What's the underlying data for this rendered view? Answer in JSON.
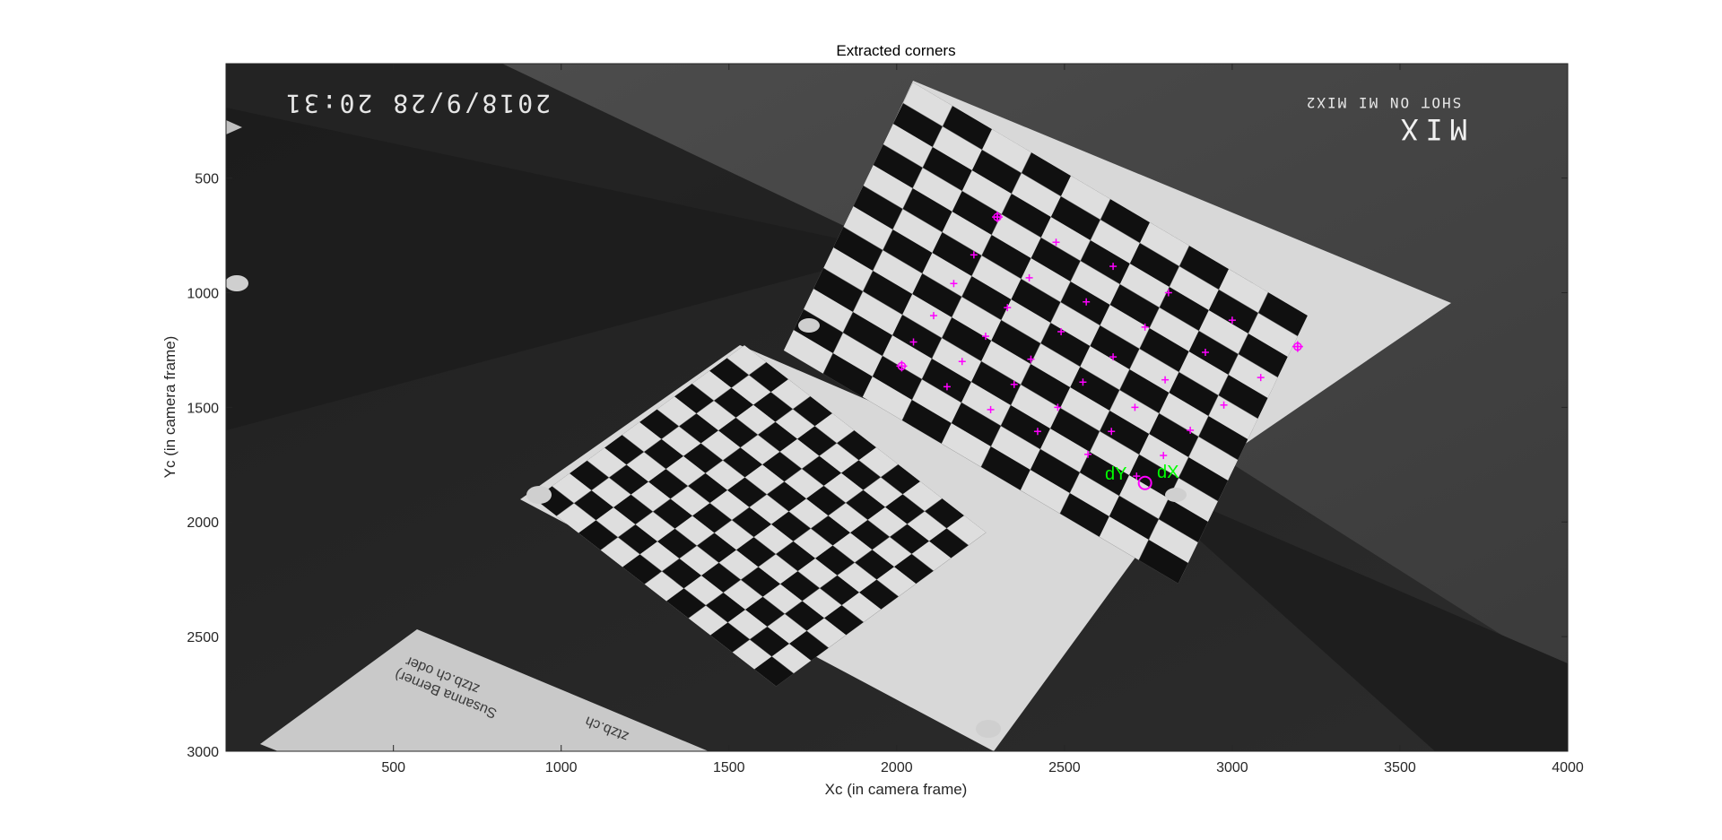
{
  "figure": {
    "title": "Extracted corners",
    "xlabel": "Xc (in camera frame)",
    "ylabel": "Yc (in camera frame)",
    "x_ticks": [
      "500",
      "1000",
      "1500",
      "2000",
      "2500",
      "3000",
      "3500",
      "4000"
    ],
    "y_ticks": [
      "500",
      "1000",
      "1500",
      "2000",
      "2500",
      "3000"
    ]
  },
  "image_overlay": {
    "timestamp": "2018/9/28 20:31",
    "brand": "MIX",
    "shot_on": "SHOT ON MI MIX2",
    "paper_lines": [
      "Susanna Berner)",
      "ztzb.ch oder",
      "ztzb.ch"
    ]
  },
  "origin_markers": {
    "dx_label": "dX",
    "dy_label": "dY",
    "origin_label": "O"
  },
  "chart_data": {
    "type": "scatter",
    "title": "Extracted corners",
    "xlabel": "Xc (in camera frame)",
    "ylabel": "Yc (in camera frame)",
    "xlim": [
      1,
      4000
    ],
    "ylim": [
      3000,
      1
    ],
    "y_reversed": true,
    "x_ticks": [
      500,
      1000,
      1500,
      2000,
      2500,
      3000,
      3500,
      4000
    ],
    "y_ticks": [
      500,
      1000,
      1500,
      2000,
      2500,
      3000
    ],
    "grid": false,
    "marker_color": "#ff00ff",
    "label_color": "#00ff00",
    "series": [
      {
        "values": [
          {
            "x": 2300,
            "y": 670
          },
          {
            "x": 2475,
            "y": 780
          },
          {
            "x": 2645,
            "y": 885
          },
          {
            "x": 2810,
            "y": 1000
          },
          {
            "x": 3000,
            "y": 1120
          },
          {
            "x": 3195,
            "y": 1235
          },
          {
            "x": 2230,
            "y": 835
          },
          {
            "x": 2395,
            "y": 935
          },
          {
            "x": 2565,
            "y": 1040
          },
          {
            "x": 2740,
            "y": 1150
          },
          {
            "x": 2920,
            "y": 1260
          },
          {
            "x": 3085,
            "y": 1370
          },
          {
            "x": 2170,
            "y": 960
          },
          {
            "x": 2330,
            "y": 1065
          },
          {
            "x": 2490,
            "y": 1170
          },
          {
            "x": 2645,
            "y": 1280
          },
          {
            "x": 2800,
            "y": 1380
          },
          {
            "x": 2975,
            "y": 1490
          },
          {
            "x": 2110,
            "y": 1100
          },
          {
            "x": 2265,
            "y": 1190
          },
          {
            "x": 2400,
            "y": 1290
          },
          {
            "x": 2555,
            "y": 1390
          },
          {
            "x": 2710,
            "y": 1500
          },
          {
            "x": 2875,
            "y": 1600
          },
          {
            "x": 2050,
            "y": 1215
          },
          {
            "x": 2195,
            "y": 1300
          },
          {
            "x": 2350,
            "y": 1400
          },
          {
            "x": 2480,
            "y": 1500
          },
          {
            "x": 2640,
            "y": 1605
          },
          {
            "x": 2795,
            "y": 1710
          },
          {
            "x": 2015,
            "y": 1320
          },
          {
            "x": 2150,
            "y": 1410
          },
          {
            "x": 2280,
            "y": 1510
          },
          {
            "x": 2420,
            "y": 1605
          },
          {
            "x": 2570,
            "y": 1705
          },
          {
            "x": 2715,
            "y": 1800
          }
        ]
      }
    ],
    "highlighted_points": [
      {
        "x": 2300,
        "y": 670
      },
      {
        "x": 3195,
        "y": 1235
      },
      {
        "x": 2015,
        "y": 1320
      }
    ],
    "origin": {
      "x": 2740,
      "y": 1830
    },
    "annotations": [
      "dX",
      "dY",
      "O"
    ]
  }
}
